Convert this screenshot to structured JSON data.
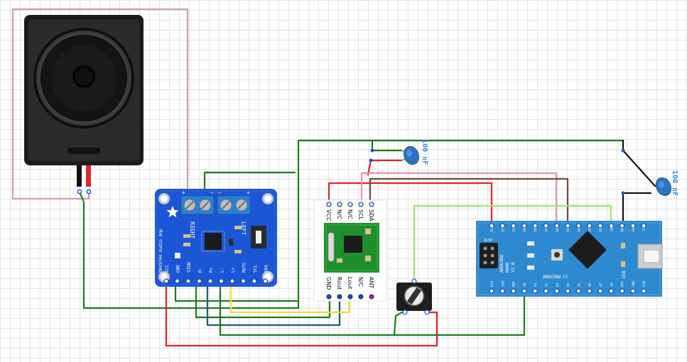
{
  "amplifier": {
    "name": "MAX9744 Audio Amp",
    "channel_right": "RIGHT",
    "channel_left": "LEFT",
    "pins": [
      "VCC",
      "GND",
      "STDN",
      "R-",
      "R+",
      "L-",
      "L+",
      "MUTE",
      "SCL",
      "SDA"
    ]
  },
  "radio": {
    "top_pins": [
      "VCC",
      "N/C",
      "N/C",
      "SCL",
      "SDA"
    ],
    "bottom_pins": [
      "GND",
      "Rout",
      "Lout",
      "N/C",
      "ANT"
    ]
  },
  "arduino": {
    "name": "ARDUINO",
    "model": "NANO",
    "version": "V3.0",
    "brand": "ARDUINO.CC",
    "usb_label": "USB",
    "icsp_label": "ICSP",
    "top_pins": [
      "D12",
      "D11",
      "D10",
      "D9",
      "D8",
      "D7",
      "D6",
      "D5",
      "D4",
      "D3",
      "D2",
      "GND",
      "RST",
      "RX0",
      "TX1"
    ],
    "bottom_pins": [
      "D13",
      "3V3",
      "REF",
      "A0",
      "A1",
      "A2",
      "A3",
      "A4",
      "A5",
      "A6",
      "A7",
      "5V",
      "RST",
      "GND",
      "VIN"
    ]
  },
  "capacitors": [
    {
      "label": "100 nF"
    },
    {
      "label": "100 nF"
    }
  ],
  "colors": {
    "green": "#1f7a1f",
    "red": "#e2232a",
    "pink": "#f08fb3",
    "brown": "#6b4a3a",
    "lime": "#97e86a",
    "yellow": "#f2de3a",
    "teal": "#1f5c6e",
    "black": "#111111",
    "grey_pink": "#c9a1ad",
    "board_blue": "#1a56d6",
    "nano_blue": "#2e8ad0"
  }
}
